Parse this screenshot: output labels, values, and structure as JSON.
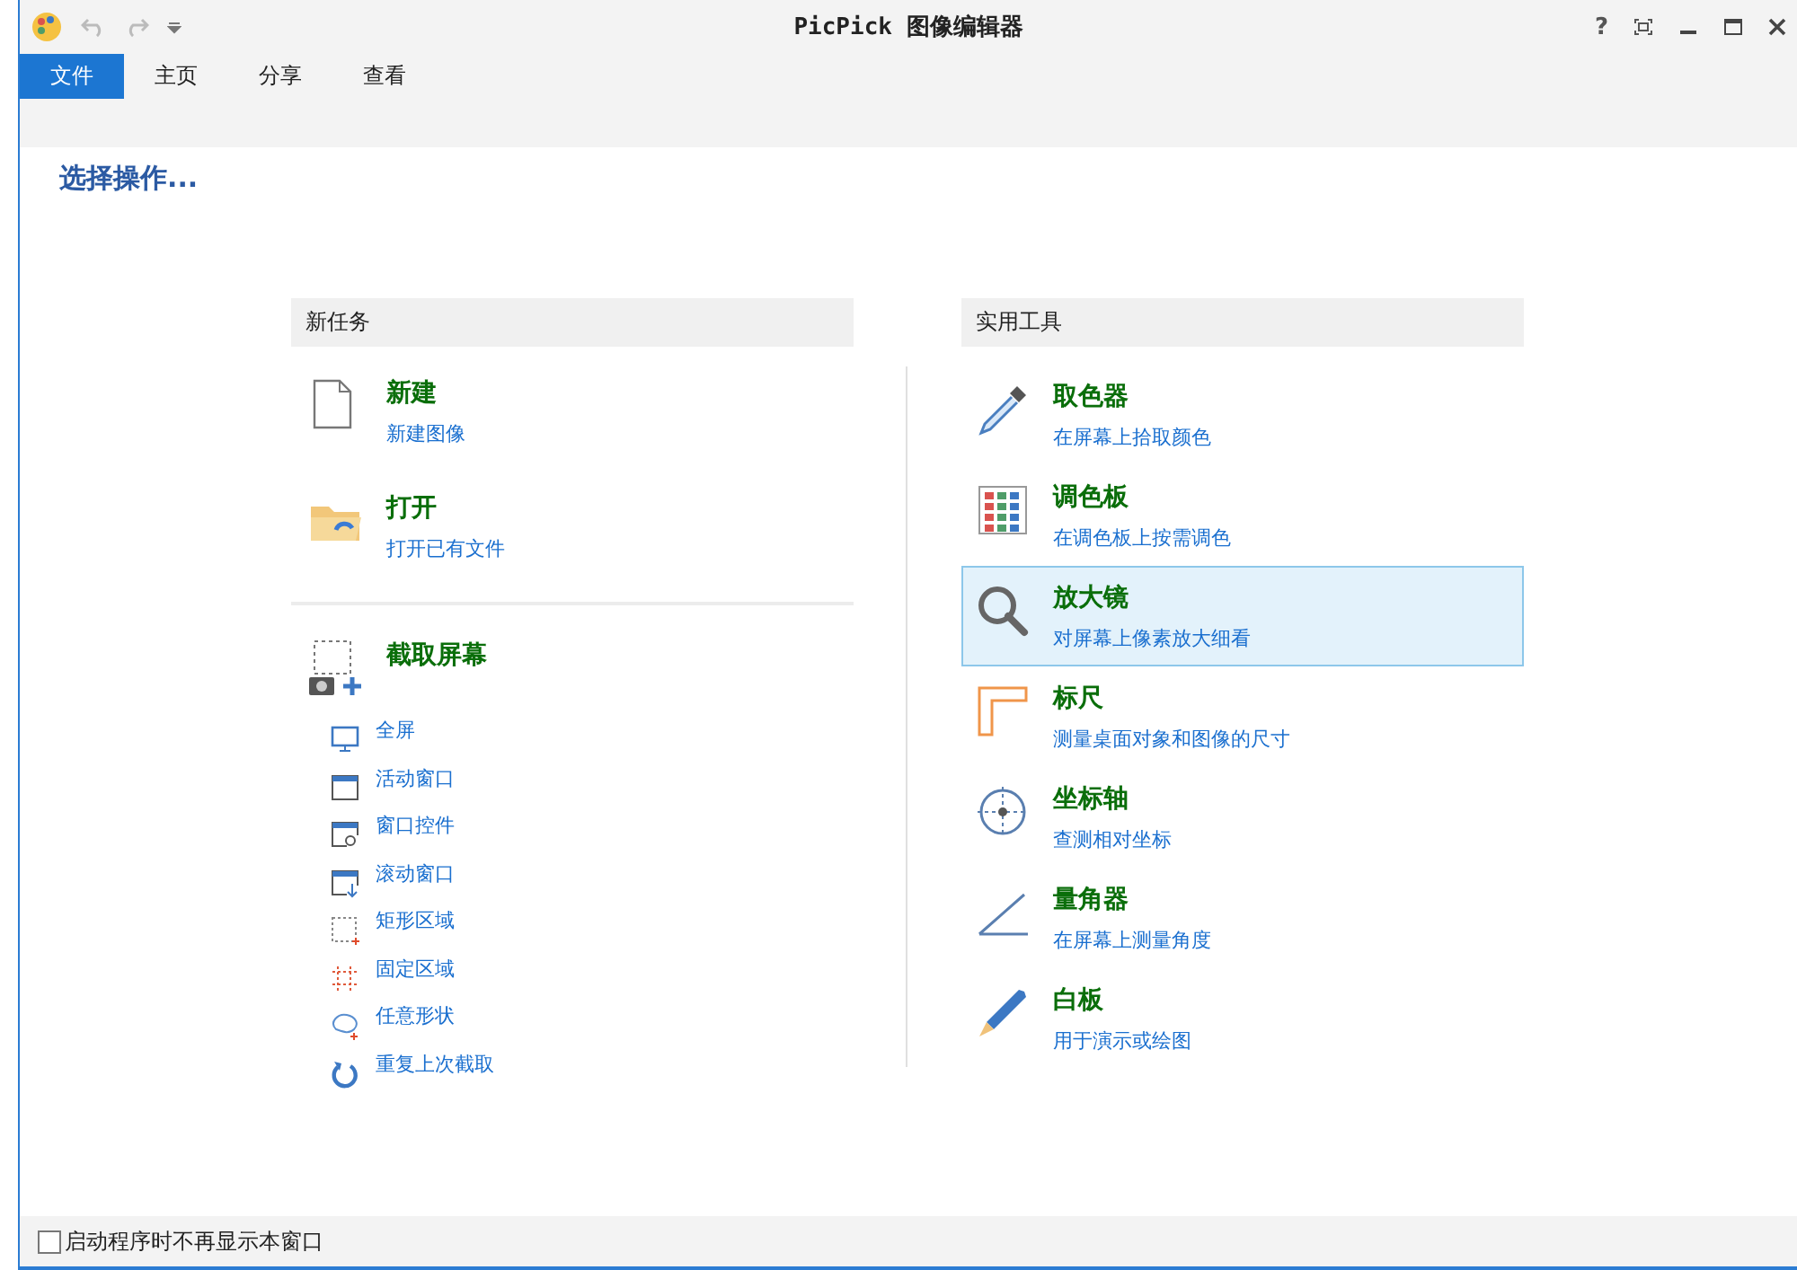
{
  "window": {
    "title": "PicPick 图像编辑器",
    "controls": [
      "?"
    ]
  },
  "tabs": [
    {
      "label": "文件",
      "selected": true
    },
    {
      "label": "主页",
      "selected": false
    },
    {
      "label": "分享",
      "selected": false
    },
    {
      "label": "查看",
      "selected": false
    }
  ],
  "heading": "选择操作...",
  "new_tasks": {
    "title": "新任务",
    "items": [
      {
        "title": "新建",
        "subtitle": "新建图像"
      },
      {
        "title": "打开",
        "subtitle": "打开已有文件"
      }
    ],
    "capture": {
      "title": "截取屏幕",
      "items": [
        "全屏",
        "活动窗口",
        "窗口控件",
        "滚动窗口",
        "矩形区域",
        "固定区域",
        "任意形状",
        "重复上次截取"
      ]
    }
  },
  "tools": {
    "title": "实用工具",
    "items": [
      {
        "title": "取色器",
        "subtitle": "在屏幕上拾取颜色",
        "selected": false
      },
      {
        "title": "调色板",
        "subtitle": "在调色板上按需调色",
        "selected": false
      },
      {
        "title": "放大镜",
        "subtitle": "对屏幕上像素放大细看",
        "selected": true
      },
      {
        "title": "标尺",
        "subtitle": "测量桌面对象和图像的尺寸",
        "selected": false
      },
      {
        "title": "坐标轴",
        "subtitle": "查测相对坐标",
        "selected": false
      },
      {
        "title": "量角器",
        "subtitle": "在屏幕上测量角度",
        "selected": false
      },
      {
        "title": "白板",
        "subtitle": "用于演示或绘图",
        "selected": false
      }
    ]
  },
  "footer": {
    "label": "启动程序时不再显示本窗口",
    "checked": false
  }
}
